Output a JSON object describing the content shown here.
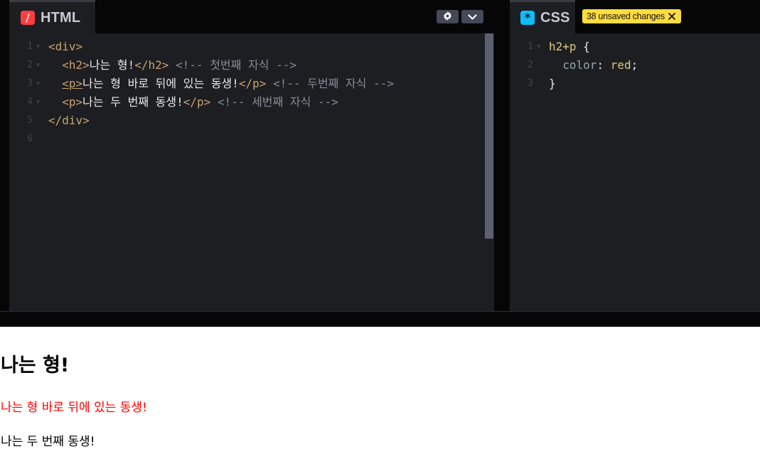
{
  "html_pane": {
    "tab_label": "HTML",
    "icon": "html-slash-icon",
    "accent": "#ff3c41",
    "controls": {
      "settings_icon": "gear-icon",
      "toggle_icon": "chevron-down-icon"
    },
    "lines": [
      {
        "n": "1",
        "parts": [
          {
            "t": "<div>",
            "c": "tag"
          }
        ]
      },
      {
        "n": "2",
        "parts": [
          {
            "t": "  "
          },
          {
            "t": "<h2>",
            "c": "tag"
          },
          {
            "t": "나는 형!",
            "c": "text"
          },
          {
            "t": "</h2>",
            "c": "tag"
          },
          {
            "t": " "
          },
          {
            "t": "<!-- 첫번째 자식 -->",
            "c": "comment"
          }
        ]
      },
      {
        "n": "3",
        "parts": [
          {
            "t": "  "
          },
          {
            "t": "<p>",
            "c": "tag",
            "u": true
          },
          {
            "t": "나는 형 바로 뒤에 있는 동생!",
            "c": "text"
          },
          {
            "t": "</p>",
            "c": "tag"
          },
          {
            "t": " "
          },
          {
            "t": "<!-- 두번째 자식 -->",
            "c": "comment"
          }
        ]
      },
      {
        "n": "4",
        "parts": [
          {
            "t": "  "
          },
          {
            "t": "<p>",
            "c": "tag"
          },
          {
            "t": "나는 두 번째 동생!",
            "c": "text"
          },
          {
            "t": "</p>",
            "c": "tag"
          },
          {
            "t": " "
          },
          {
            "t": "<!-- 세번째 자식 -->",
            "c": "comment"
          }
        ]
      },
      {
        "n": "5",
        "parts": [
          {
            "t": "</div>",
            "c": "tag"
          }
        ]
      },
      {
        "n": "6",
        "parts": []
      }
    ]
  },
  "css_pane": {
    "tab_label": "CSS",
    "icon": "css-asterisk-icon",
    "accent": "#0ebeff",
    "unsaved_badge": "38 unsaved changes",
    "lines": [
      {
        "n": "1",
        "parts": [
          {
            "t": "h2+p",
            "c": "sel"
          },
          {
            "t": " {",
            "c": "punc"
          }
        ]
      },
      {
        "n": "2",
        "parts": [
          {
            "t": "  "
          },
          {
            "t": "color",
            "c": "prop"
          },
          {
            "t": ": ",
            "c": "punc"
          },
          {
            "t": "red",
            "c": "val"
          },
          {
            "t": ";",
            "c": "punc"
          }
        ]
      },
      {
        "n": "3",
        "parts": [
          {
            "t": "}",
            "c": "punc"
          }
        ]
      }
    ]
  },
  "result": {
    "heading": "나는 형!",
    "paragraph_1": "나는 형 바로 뒤에 있는 동생!",
    "paragraph_2": "나는 두 번째 동생!",
    "highlight_color": "#ff0000"
  }
}
